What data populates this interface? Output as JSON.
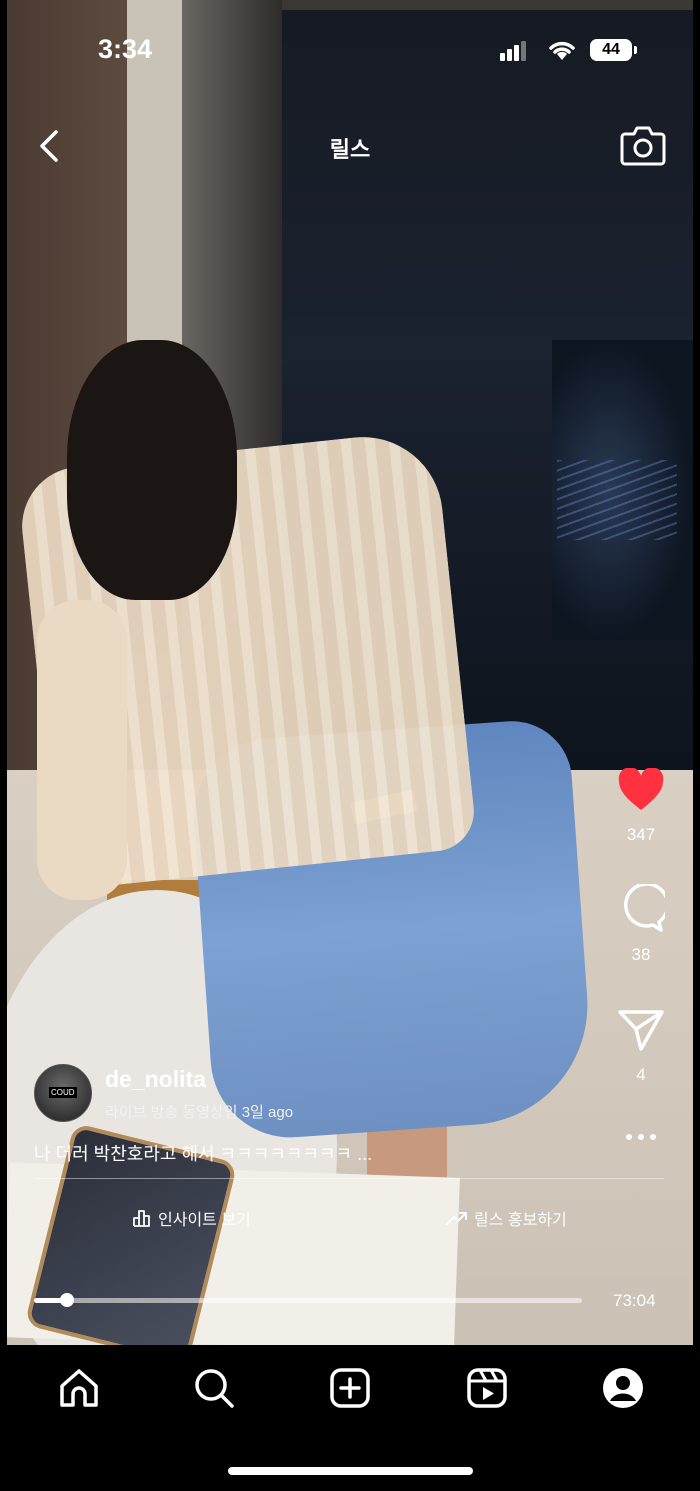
{
  "status_bar": {
    "time": "3:34",
    "battery": "44"
  },
  "header": {
    "title": "릴스",
    "back_icon": "chevron-left-icon",
    "camera_icon": "camera-icon"
  },
  "actions": {
    "like": {
      "icon": "heart-icon",
      "count": "347",
      "liked": true,
      "color": "#ff3040"
    },
    "comment": {
      "icon": "comment-bubble-icon",
      "count": "38"
    },
    "share": {
      "icon": "paper-plane-icon",
      "count": "4"
    },
    "more": {
      "icon": "more-horizontal-icon"
    }
  },
  "post": {
    "username": "de_nolita",
    "subtitle": "라이브 방송 동영상임 3일 ago",
    "caption": "나 더러 박찬호라고 해서 ㅋㅋㅋㅋㅋㅋㅋㅋ ...",
    "avatar_badge": "COUD"
  },
  "buttons": {
    "insight": "인사이트 보기",
    "promote": "릴스 홍보하기"
  },
  "playback": {
    "progress": 0.06,
    "duration": "73:04"
  },
  "nav": [
    {
      "icon": "home-icon"
    },
    {
      "icon": "search-icon"
    },
    {
      "icon": "create-post-icon"
    },
    {
      "icon": "reels-icon"
    },
    {
      "icon": "profile-icon"
    }
  ]
}
